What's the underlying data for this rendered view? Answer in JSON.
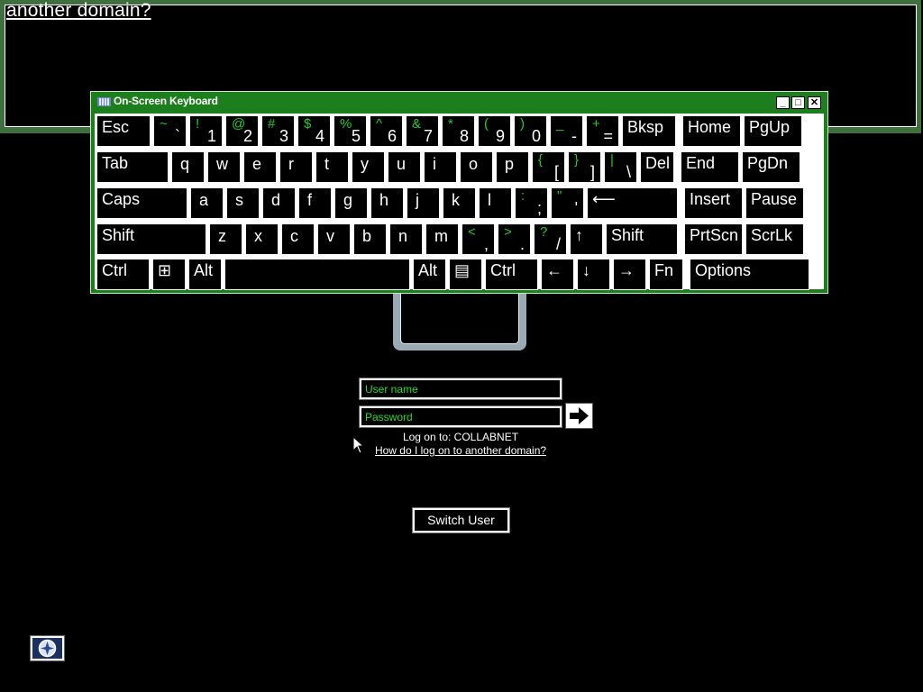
{
  "help_window": {
    "link_fragment": "another domain?"
  },
  "osk": {
    "title": "On-Screen Keyboard",
    "title_buttons": [
      "minimize",
      "maximize",
      "close"
    ],
    "colors": {
      "frame": "#1d7e1d",
      "shift_char": "#22cc22",
      "key_bg": "#000000",
      "key_border": "#ffffff"
    },
    "rows": [
      [
        {
          "name": "key-esc",
          "label": "Esc",
          "w": 60
        },
        {
          "name": "key-tilde",
          "shift": "~",
          "base": "`",
          "w": 37
        },
        {
          "name": "key-1",
          "shift": "!",
          "base": "1",
          "w": 37
        },
        {
          "name": "key-2",
          "shift": "@",
          "base": "2",
          "w": 37
        },
        {
          "name": "key-3",
          "shift": "#",
          "base": "3",
          "w": 37
        },
        {
          "name": "key-4",
          "shift": "$",
          "base": "4",
          "w": 37
        },
        {
          "name": "key-5",
          "shift": "%",
          "base": "5",
          "w": 37
        },
        {
          "name": "key-6",
          "shift": "^",
          "base": "6",
          "w": 37
        },
        {
          "name": "key-7",
          "shift": "&",
          "base": "7",
          "w": 37
        },
        {
          "name": "key-8",
          "shift": "*",
          "base": "8",
          "w": 37
        },
        {
          "name": "key-9",
          "shift": "(",
          "base": "9",
          "w": 37
        },
        {
          "name": "key-0",
          "shift": ")",
          "base": "0",
          "w": 37
        },
        {
          "name": "key-minus",
          "shift": "_",
          "base": "-",
          "w": 37
        },
        {
          "name": "key-equals",
          "shift": "+",
          "base": "=",
          "w": 37
        },
        {
          "name": "key-backspace",
          "label": "Bksp",
          "w": 60
        },
        {
          "name": "key-home",
          "label": "Home",
          "w": 65,
          "gap": 4
        },
        {
          "name": "key-pgup",
          "label": "PgUp",
          "w": 65
        }
      ],
      [
        {
          "name": "key-tab",
          "label": "Tab",
          "w": 80
        },
        {
          "name": "key-q",
          "small": "q",
          "w": 37
        },
        {
          "name": "key-w",
          "small": "w",
          "w": 37
        },
        {
          "name": "key-e",
          "small": "e",
          "w": 37
        },
        {
          "name": "key-r",
          "small": "r",
          "w": 37
        },
        {
          "name": "key-t",
          "small": "t",
          "w": 37
        },
        {
          "name": "key-y",
          "small": "y",
          "w": 37
        },
        {
          "name": "key-u",
          "small": "u",
          "w": 37
        },
        {
          "name": "key-i",
          "small": "i",
          "w": 37
        },
        {
          "name": "key-o",
          "small": "o",
          "w": 37
        },
        {
          "name": "key-p",
          "small": "p",
          "w": 37
        },
        {
          "name": "key-lbracket",
          "shift": "{",
          "base": "[",
          "w": 37
        },
        {
          "name": "key-rbracket",
          "shift": "}",
          "base": "]",
          "w": 37
        },
        {
          "name": "key-backslash",
          "shift": "|",
          "base": "\\",
          "w": 37
        },
        {
          "name": "key-del",
          "label": "Del",
          "w": 38
        },
        {
          "name": "key-end",
          "label": "End",
          "w": 65,
          "gap": 4
        },
        {
          "name": "key-pgdn",
          "label": "PgDn",
          "w": 65
        }
      ],
      [
        {
          "name": "key-caps",
          "label": "Caps",
          "w": 101
        },
        {
          "name": "key-a",
          "small": "a",
          "w": 37
        },
        {
          "name": "key-s",
          "small": "s",
          "w": 37
        },
        {
          "name": "key-d",
          "small": "d",
          "w": 37
        },
        {
          "name": "key-f",
          "small": "f",
          "w": 37
        },
        {
          "name": "key-g",
          "small": "g",
          "w": 37
        },
        {
          "name": "key-h",
          "small": "h",
          "w": 37
        },
        {
          "name": "key-j",
          "small": "j",
          "w": 37
        },
        {
          "name": "key-k",
          "small": "k",
          "w": 37
        },
        {
          "name": "key-l",
          "small": "l",
          "w": 37
        },
        {
          "name": "key-semicolon",
          "shift": ":",
          "base": ";",
          "w": 37
        },
        {
          "name": "key-quote",
          "shift": "\"",
          "base": "'",
          "w": 37
        },
        {
          "name": "key-enter",
          "label": "⟵",
          "w": 101
        },
        {
          "name": "key-insert",
          "label": "Insert",
          "w": 65,
          "gap": 4
        },
        {
          "name": "key-pause",
          "label": "Pause",
          "w": 65
        }
      ],
      [
        {
          "name": "key-lshift",
          "label": "Shift",
          "w": 122
        },
        {
          "name": "key-z",
          "small": "z",
          "w": 37
        },
        {
          "name": "key-x",
          "small": "x",
          "w": 37
        },
        {
          "name": "key-c",
          "small": "c",
          "w": 37
        },
        {
          "name": "key-v",
          "small": "v",
          "w": 37
        },
        {
          "name": "key-b",
          "small": "b",
          "w": 37
        },
        {
          "name": "key-n",
          "small": "n",
          "w": 37
        },
        {
          "name": "key-m",
          "small": "m",
          "w": 37
        },
        {
          "name": "key-comma",
          "shift": "<",
          "base": ",",
          "w": 37
        },
        {
          "name": "key-period",
          "shift": ">",
          "base": ".",
          "w": 37
        },
        {
          "name": "key-slash",
          "shift": "?",
          "base": "/",
          "w": 37
        },
        {
          "name": "key-up",
          "label": "↑",
          "w": 37
        },
        {
          "name": "key-rshift",
          "label": "Shift",
          "w": 80
        },
        {
          "name": "key-prtscn",
          "label": "PrtScn",
          "w": 65,
          "gap": 4
        },
        {
          "name": "key-scrlk",
          "label": "ScrLk",
          "w": 65
        }
      ],
      [
        {
          "name": "key-lctrl",
          "label": "Ctrl",
          "w": 59
        },
        {
          "name": "key-windows",
          "label": "⊞",
          "w": 37
        },
        {
          "name": "key-lalt",
          "label": "Alt",
          "w": 37
        },
        {
          "name": "key-space",
          "label": "",
          "w": 206
        },
        {
          "name": "key-ralt",
          "label": "Alt",
          "w": 37
        },
        {
          "name": "key-menu",
          "label": "▤",
          "w": 37
        },
        {
          "name": "key-rctrl",
          "label": "Ctrl",
          "w": 59
        },
        {
          "name": "key-left",
          "label": "←",
          "w": 37
        },
        {
          "name": "key-down",
          "label": "↓",
          "w": 37
        },
        {
          "name": "key-right",
          "label": "→",
          "w": 37
        },
        {
          "name": "key-fn",
          "label": "Fn",
          "w": 38
        },
        {
          "name": "key-options",
          "label": "Options",
          "w": 133,
          "gap": 4
        }
      ]
    ]
  },
  "logon": {
    "username_placeholder": "User name",
    "password_placeholder": "Password",
    "submit_icon": "arrow-right-icon",
    "log_on_to": "Log on to: COLLABNET",
    "domain_link": "How do I log on to another domain?",
    "switch_user": "Switch User",
    "ease_of_access_icon": "ease-of-access-icon"
  }
}
